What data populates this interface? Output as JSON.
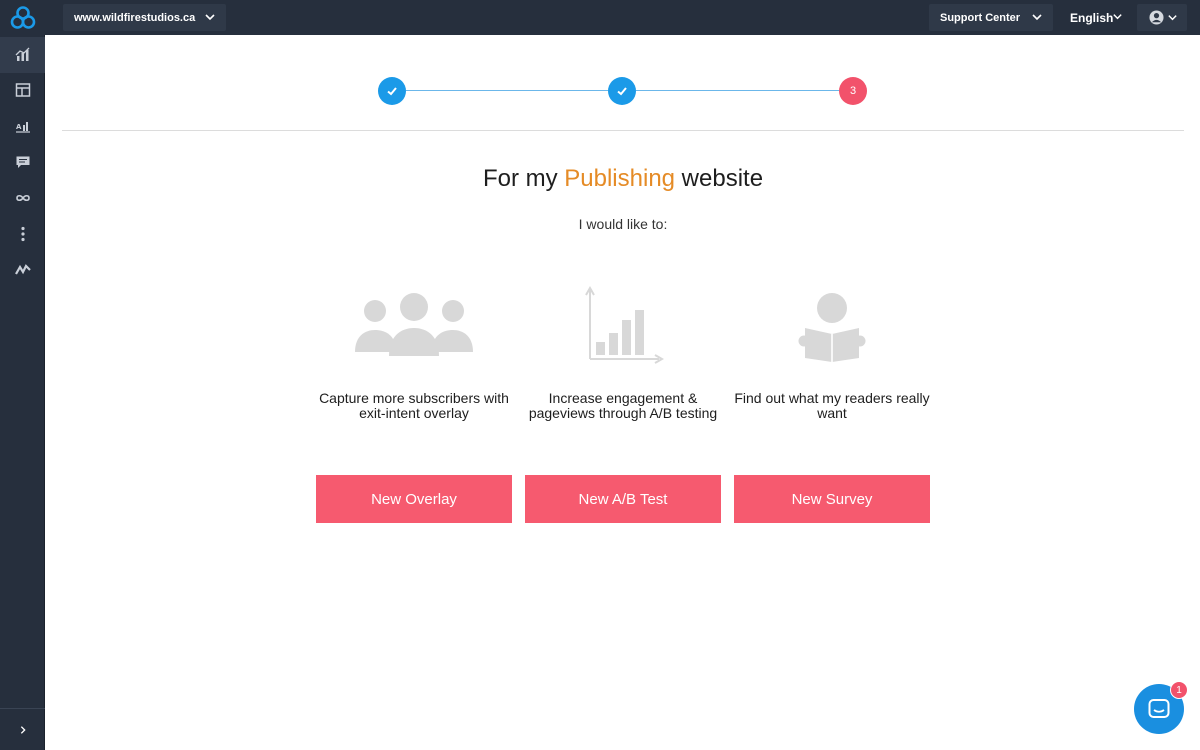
{
  "topbar": {
    "site": "www.wildfirestudios.ca",
    "support_label": "Support Center",
    "language": "English"
  },
  "sidebar": {
    "items": [
      {
        "icon": "analytics-icon"
      },
      {
        "icon": "layout-icon"
      },
      {
        "icon": "ab-test-icon"
      },
      {
        "icon": "survey-icon"
      },
      {
        "icon": "integrations-icon"
      },
      {
        "icon": "more-icon"
      },
      {
        "icon": "analytics-line-icon"
      }
    ],
    "expand_icon": "chevron-right-icon"
  },
  "stepper": {
    "steps": [
      {
        "state": "done"
      },
      {
        "state": "done"
      },
      {
        "state": "current",
        "label": "3"
      }
    ]
  },
  "heading": {
    "prefix": "For my ",
    "highlight": "Publishing",
    "suffix": " website",
    "highlight_color": "#e58b26"
  },
  "subheading": "I would like to:",
  "cards": [
    {
      "icon": "users-icon",
      "text": "Capture more subscribers with exit-intent overlay",
      "button": "New Overlay"
    },
    {
      "icon": "bar-chart-icon",
      "text": "Increase engagement & pageviews through A/B testing",
      "button": "New A/B Test"
    },
    {
      "icon": "reader-icon",
      "text": "Find out what my readers really want",
      "button": "New Survey"
    }
  ],
  "chat": {
    "badge": "1"
  },
  "colors": {
    "primary_button": "#f65a6f",
    "step_done": "#1b9ae8",
    "step_current": "#f2526b",
    "topbar": "#262f3d"
  }
}
